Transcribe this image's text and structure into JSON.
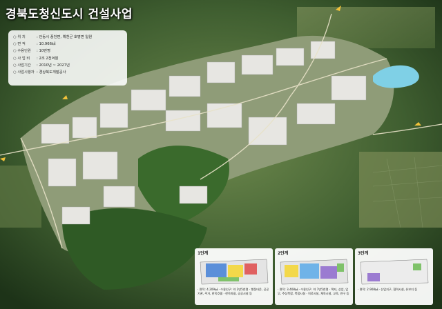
{
  "title": "경북도청신도시 건설사업",
  "info": [
    {
      "key": "위 치",
      "value": ": 안동시 풍천면, 예천군 호명면 일원"
    },
    {
      "key": "면 적",
      "value": ": 10.966㎢"
    },
    {
      "key": "수용인원",
      "value": ": 10만명"
    },
    {
      "key": "사 업 비",
      "value": ": 2조 2천억원"
    },
    {
      "key": "사업기간",
      "value": ": 2010년 ~ 2027년"
    },
    {
      "key": "사업시행자",
      "value": ": 경상북도개발공사"
    }
  ],
  "phases": [
    {
      "label": "1단계",
      "desc": "· 면적: 4.209㎢ · 수용인구: 약 2만5천명 · 행정타운, 공공기관, 주거, 한옥호텔 · 한옥마을, 공공시설 등"
    },
    {
      "label": "2단계",
      "desc": "· 면적: 3.408㎢ · 수용인구: 약 7만5천명 · 택지, 상업, 업무, 주상복합, 복합시설 · 의료시설, 체육시설, 교육, 연구 등"
    },
    {
      "label": "3단계",
      "desc": "· 면적: 2.908㎢ · 산업지구, 협력시설, 유보지 등"
    }
  ],
  "colors": {
    "title": "#ffffff",
    "lake": "#7fd0e6",
    "forest": "#2f5a25",
    "road": "#e8e2c8"
  }
}
